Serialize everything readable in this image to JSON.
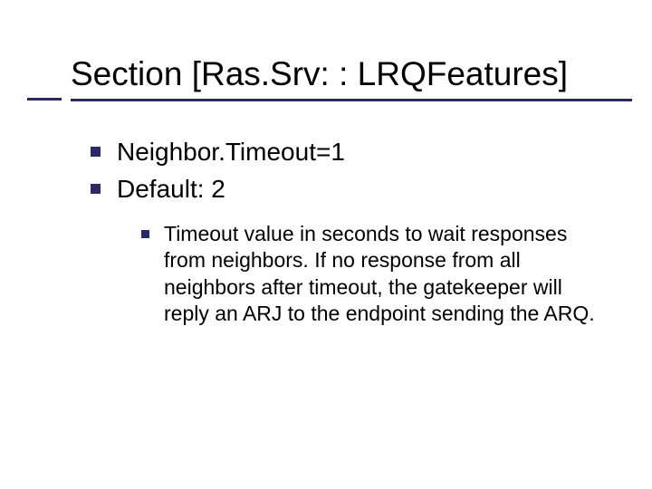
{
  "title": "Section [Ras.Srv: : LRQFeatures]",
  "bullets": {
    "lvl1": [
      "Neighbor.Timeout=1",
      "Default: 2"
    ],
    "lvl2": [
      "Timeout value in seconds to wait responses from neighbors. If no response from all neighbors after timeout, the gatekeeper will reply an ARJ to the endpoint sending the ARQ."
    ]
  }
}
